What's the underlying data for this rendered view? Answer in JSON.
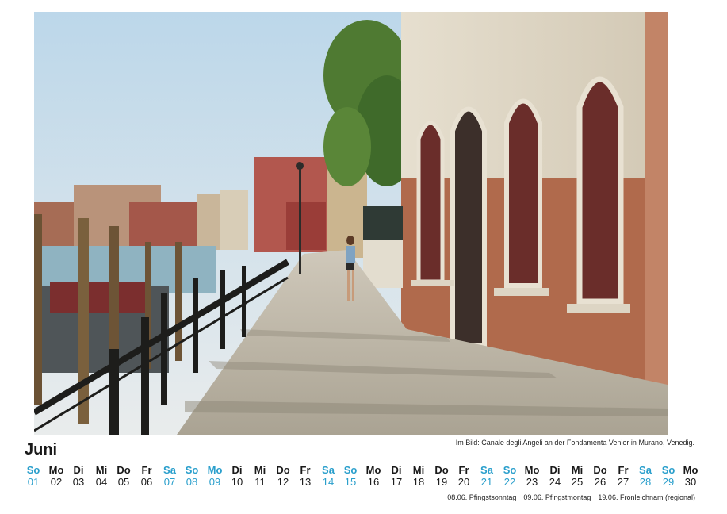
{
  "photo": {
    "alt": "Canale degli Angeli an der Fondamenta Venier in Murano, Venedig"
  },
  "caption": "Im Bild: Canale degli Angeli an der Fondamenta Venier in Murano, Venedig.",
  "month": "Juni",
  "colors": {
    "accent": "#2a9fcc",
    "text": "#1a1a1a"
  },
  "days": [
    {
      "wd": "So",
      "d": "01",
      "hl": true
    },
    {
      "wd": "Mo",
      "d": "02",
      "hl": false
    },
    {
      "wd": "Di",
      "d": "03",
      "hl": false
    },
    {
      "wd": "Mi",
      "d": "04",
      "hl": false
    },
    {
      "wd": "Do",
      "d": "05",
      "hl": false
    },
    {
      "wd": "Fr",
      "d": "06",
      "hl": false
    },
    {
      "wd": "Sa",
      "d": "07",
      "hl": true
    },
    {
      "wd": "So",
      "d": "08",
      "hl": true
    },
    {
      "wd": "Mo",
      "d": "09",
      "hl": true
    },
    {
      "wd": "Di",
      "d": "10",
      "hl": false
    },
    {
      "wd": "Mi",
      "d": "11",
      "hl": false
    },
    {
      "wd": "Do",
      "d": "12",
      "hl": false
    },
    {
      "wd": "Fr",
      "d": "13",
      "hl": false
    },
    {
      "wd": "Sa",
      "d": "14",
      "hl": true
    },
    {
      "wd": "So",
      "d": "15",
      "hl": true
    },
    {
      "wd": "Mo",
      "d": "16",
      "hl": false
    },
    {
      "wd": "Di",
      "d": "17",
      "hl": false
    },
    {
      "wd": "Mi",
      "d": "18",
      "hl": false
    },
    {
      "wd": "Do",
      "d": "19",
      "hl": false
    },
    {
      "wd": "Fr",
      "d": "20",
      "hl": false
    },
    {
      "wd": "Sa",
      "d": "21",
      "hl": true
    },
    {
      "wd": "So",
      "d": "22",
      "hl": true
    },
    {
      "wd": "Mo",
      "d": "23",
      "hl": false
    },
    {
      "wd": "Di",
      "d": "24",
      "hl": false
    },
    {
      "wd": "Mi",
      "d": "25",
      "hl": false
    },
    {
      "wd": "Do",
      "d": "26",
      "hl": false
    },
    {
      "wd": "Fr",
      "d": "27",
      "hl": false
    },
    {
      "wd": "Sa",
      "d": "28",
      "hl": true
    },
    {
      "wd": "So",
      "d": "29",
      "hl": true
    },
    {
      "wd": "Mo",
      "d": "30",
      "hl": false
    }
  ],
  "holidays": [
    "08.06. Pfingstsonntag",
    "09.06. Pfingstmontag",
    "19.06. Fronleichnam (regional)"
  ]
}
